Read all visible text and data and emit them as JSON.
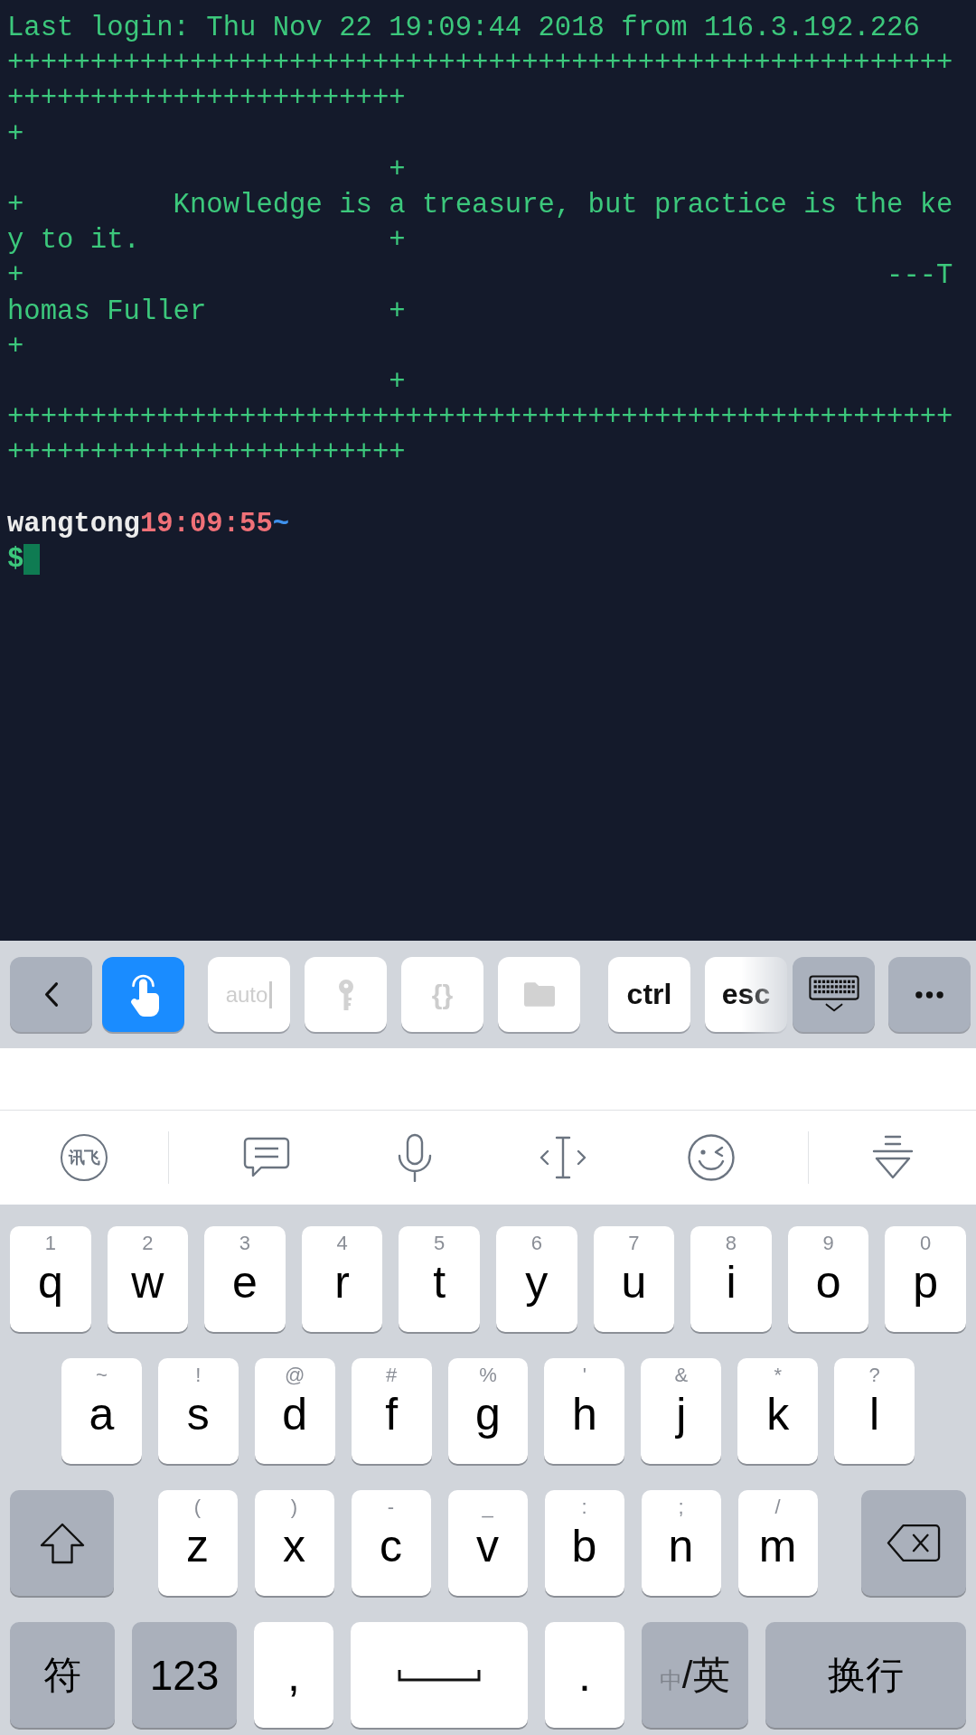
{
  "terminal": {
    "lines": [
      "Last login: Thu Nov 22 19:09:44 2018 from 116.3.192.226",
      "+++++++++++++++++++++++++++++++++++++++++++++++++++++++++",
      "++++++++++++++++++++++++",
      "+",
      "                       +",
      "+         Knowledge is a treasure, but practice is the ke",
      "y to it.               +",
      "+                                                    ---T",
      "homas Fuller           +",
      "+",
      "                       +",
      "+++++++++++++++++++++++++++++++++++++++++++++++++++++++++",
      "++++++++++++++++++++++++"
    ],
    "prompt": {
      "user": "wangtong",
      "time": "19:09:55",
      "path": "~",
      "symbol": "$"
    }
  },
  "accessory_bar": {
    "left": [
      {
        "kind": "back"
      },
      {
        "kind": "touch",
        "on": true
      }
    ],
    "tools": [
      {
        "kind": "label",
        "label": "auto",
        "caret": true,
        "disabled": true
      },
      {
        "kind": "key",
        "disabled": true
      },
      {
        "kind": "label",
        "label": "{}",
        "disabled": true
      },
      {
        "kind": "folder",
        "disabled": true
      }
    ],
    "keys": [
      {
        "label": "ctrl"
      },
      {
        "label": "esc"
      }
    ],
    "right": [
      {
        "kind": "keyboard"
      },
      {
        "kind": "more"
      }
    ]
  },
  "ime_bar": {
    "logo": "讯飞",
    "tools": [
      {
        "kind": "chat"
      },
      {
        "kind": "mic"
      },
      {
        "kind": "cursor"
      },
      {
        "kind": "emoji"
      }
    ],
    "trailing": [
      {
        "kind": "collapse"
      }
    ]
  },
  "keyboard": {
    "rows": [
      [
        {
          "kind": "char",
          "label": "q",
          "hint": "1"
        },
        {
          "kind": "char",
          "label": "w",
          "hint": "2"
        },
        {
          "kind": "char",
          "label": "e",
          "hint": "3"
        },
        {
          "kind": "char",
          "label": "r",
          "hint": "4"
        },
        {
          "kind": "char",
          "label": "t",
          "hint": "5"
        },
        {
          "kind": "char",
          "label": "y",
          "hint": "6"
        },
        {
          "kind": "char",
          "label": "u",
          "hint": "7"
        },
        {
          "kind": "char",
          "label": "i",
          "hint": "8"
        },
        {
          "kind": "char",
          "label": "o",
          "hint": "9"
        },
        {
          "kind": "char",
          "label": "p",
          "hint": "0"
        }
      ],
      [
        {
          "kind": "char",
          "label": "a",
          "hint": "~"
        },
        {
          "kind": "char",
          "label": "s",
          "hint": "!"
        },
        {
          "kind": "char",
          "label": "d",
          "hint": "@"
        },
        {
          "kind": "char",
          "label": "f",
          "hint": "#"
        },
        {
          "kind": "char",
          "label": "g",
          "hint": "%"
        },
        {
          "kind": "char",
          "label": "h",
          "hint": "'"
        },
        {
          "kind": "char",
          "label": "j",
          "hint": "&"
        },
        {
          "kind": "char",
          "label": "k",
          "hint": "*"
        },
        {
          "kind": "char",
          "label": "l",
          "hint": "?"
        }
      ],
      [
        {
          "kind": "shift"
        },
        {
          "kind": "char",
          "label": "z",
          "hint": "("
        },
        {
          "kind": "char",
          "label": "x",
          "hint": ")"
        },
        {
          "kind": "char",
          "label": "c",
          "hint": "-"
        },
        {
          "kind": "char",
          "label": "v",
          "hint": "_"
        },
        {
          "kind": "char",
          "label": "b",
          "hint": ":"
        },
        {
          "kind": "char",
          "label": "n",
          "hint": ";"
        },
        {
          "kind": "char",
          "label": "m",
          "hint": "/"
        },
        {
          "kind": "delete"
        }
      ]
    ],
    "bottom_row": {
      "left": [
        {
          "kind": "func",
          "label": "符"
        },
        {
          "kind": "func",
          "label": "123"
        },
        {
          "kind": "char",
          "label": ","
        }
      ],
      "space": {
        "kind": "space"
      },
      "right": [
        {
          "kind": "char",
          "label": "."
        },
        {
          "kind": "lang",
          "secondary": "中",
          "label": "/英"
        },
        {
          "kind": "return",
          "label": "换行"
        }
      ]
    }
  }
}
